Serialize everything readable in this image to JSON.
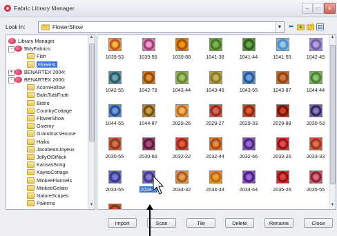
{
  "window": {
    "title": "Fabric Library Manager"
  },
  "lookin": {
    "label": "Look In:",
    "value": "FlowerShow"
  },
  "tree": [
    {
      "label": "Library Manager",
      "icon": "lib",
      "indent": 0
    },
    {
      "label": "$MyFabrics:",
      "icon": "lib",
      "indent": 1,
      "expander": "-"
    },
    {
      "label": "Fish",
      "icon": "folder",
      "indent": 2
    },
    {
      "label": "Flowers",
      "icon": "folder",
      "indent": 2,
      "selected": true
    },
    {
      "label": "BENARTEX 2004:",
      "icon": "lib",
      "indent": 1,
      "expander": "+"
    },
    {
      "label": "BENARTEX 2006:",
      "icon": "lib",
      "indent": 1,
      "expander": "-"
    },
    {
      "label": "AcornHollow",
      "icon": "folder",
      "indent": 2
    },
    {
      "label": "BalisTuttiFrutti",
      "icon": "folder",
      "indent": 2
    },
    {
      "label": "Bistro",
      "icon": "folder",
      "indent": 2
    },
    {
      "label": "CountryCottage",
      "icon": "folder",
      "indent": 2
    },
    {
      "label": "FlowerShow",
      "icon": "folder",
      "indent": 2
    },
    {
      "label": "Giverny",
      "icon": "folder",
      "indent": 2
    },
    {
      "label": "Grandma'sHouse",
      "icon": "folder",
      "indent": 2
    },
    {
      "label": "Haiku",
      "icon": "folder",
      "indent": 2
    },
    {
      "label": "JacobeanJoyeux",
      "icon": "folder",
      "indent": 2
    },
    {
      "label": "JollyOlStNick",
      "icon": "folder",
      "indent": 2
    },
    {
      "label": "KansasSong",
      "icon": "folder",
      "indent": 2
    },
    {
      "label": "KayesCottage",
      "icon": "folder",
      "indent": 2
    },
    {
      "label": "MinkeeFlannels",
      "icon": "folder",
      "indent": 2
    },
    {
      "label": "MinkeeGelato",
      "icon": "folder",
      "indent": 2
    },
    {
      "label": "NatureScapes",
      "icon": "folder",
      "indent": 2
    },
    {
      "label": "Palermo",
      "icon": "folder",
      "indent": 2
    }
  ],
  "fabrics": [
    {
      "label": "1039-53",
      "c1": "#f1c232",
      "c2": "#c0392b"
    },
    {
      "label": "1039-56",
      "c1": "#e6a3c4",
      "c2": "#8e2c6b"
    },
    {
      "label": "1039-88",
      "c1": "#f39c12",
      "c2": "#a04000"
    },
    {
      "label": "1041-38",
      "c1": "#7fb34d",
      "c2": "#3d6b1e"
    },
    {
      "label": "1041-44",
      "c1": "#6aa84f",
      "c2": "#274e13"
    },
    {
      "label": "1041-55",
      "c1": "#9fc5e8",
      "c2": "#3d85c6"
    },
    {
      "label": "1042-45",
      "c1": "#b4a7d6",
      "c2": "#674ea7"
    },
    {
      "label": "1042-55",
      "c1": "#76a5af",
      "c2": "#134f5c"
    },
    {
      "label": "1042-78",
      "c1": "#e69138",
      "c2": "#783f04"
    },
    {
      "label": "1043-44",
      "c1": "#a6c36b",
      "c2": "#5b7a25"
    },
    {
      "label": "1043-46",
      "c1": "#c9b458",
      "c2": "#7a6a1c"
    },
    {
      "label": "1043-55",
      "c1": "#6fa8dc",
      "c2": "#1c4587"
    },
    {
      "label": "1043-87",
      "c1": "#d97a3a",
      "c2": "#7f3a10"
    },
    {
      "label": "1044-44",
      "c1": "#93c47d",
      "c2": "#38761d"
    },
    {
      "label": "1044-55",
      "c1": "#6d9eeb",
      "c2": "#1c3f7a"
    },
    {
      "label": "1044-87",
      "c1": "#d0a040",
      "c2": "#5e4010"
    },
    {
      "label": "2029-26",
      "c1": "#f6b26b",
      "c2": "#b45f06"
    },
    {
      "label": "2029-27",
      "c1": "#e06666",
      "c2": "#85200c"
    },
    {
      "label": "2029-33",
      "c1": "#e05c3a",
      "c2": "#7a1f0a"
    },
    {
      "label": "2029-88",
      "c1": "#cc4125",
      "c2": "#5b0f00"
    },
    {
      "label": "2030-53",
      "c1": "#8e7cc3",
      "c2": "#20124d"
    },
    {
      "label": "2030-55",
      "c1": "#d97050",
      "c2": "#8a2a10"
    },
    {
      "label": "2030-66",
      "c1": "#a64d79",
      "c2": "#4c1130"
    },
    {
      "label": "2032-22",
      "c1": "#e06040",
      "c2": "#8a2010"
    },
    {
      "label": "2032-44",
      "c1": "#f08a3c",
      "c2": "#9a3a0a"
    },
    {
      "label": "2032-66",
      "c1": "#9a6ad0",
      "c2": "#3a1a70"
    },
    {
      "label": "2033-26",
      "c1": "#e85050",
      "c2": "#7a0a0a"
    },
    {
      "label": "2033-33",
      "c1": "#e07050",
      "c2": "#8a2a18"
    },
    {
      "label": "2033-55",
      "c1": "#7a7adc",
      "c2": "#2a2a80"
    },
    {
      "label": "2034-2",
      "c1": "#8a7ad0",
      "c2": "#3a2a7a",
      "selected": true
    },
    {
      "label": "2034-32",
      "c1": "#f0a050",
      "c2": "#a05010"
    },
    {
      "label": "2034-33",
      "c1": "#f0a030",
      "c2": "#b06000"
    },
    {
      "label": "2034-64",
      "c1": "#a06ad8",
      "c2": "#3a1070"
    },
    {
      "label": "2035-26",
      "c1": "#e84040",
      "c2": "#800808"
    },
    {
      "label": "2035-55",
      "c1": "#e07080",
      "c2": "#7a1028"
    },
    {
      "label": "",
      "c1": "#e06030",
      "c2": "#8a2008"
    }
  ],
  "buttons": {
    "import": "Import",
    "scan": "Scan",
    "tile": "Tile",
    "delete": "Delete",
    "rename": "Rename",
    "close": "Close"
  }
}
